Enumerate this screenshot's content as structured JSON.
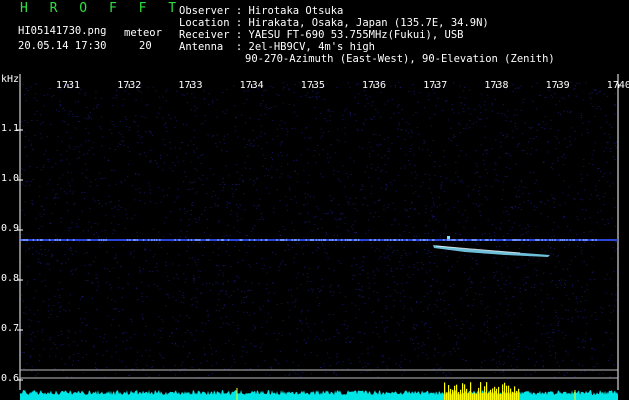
{
  "header": {
    "app_title": "H R O F F T",
    "filename": "HI05141730.png",
    "meteor_label": "meteor",
    "datetime": "20.05.14 17:30",
    "meteor_count": "20",
    "observer": "Observer : Hirotaka Otsuka",
    "location": "Location : Hirakata, Osaka, Japan (135.7E, 34.9N)",
    "receiver": "Receiver : YAESU FT-690 53.755MHz(Fukui), USB",
    "antenna": "Antenna  : 2el-HB9CV, 4m's high",
    "antenna2": "90-270-Azimuth (East-West), 90-Elevation (Zenith)"
  },
  "axes": {
    "y_unit": "kHz",
    "x_ticks": [
      "1731",
      "1732",
      "1733",
      "1734",
      "1735",
      "1736",
      "1737",
      "1738",
      "1739",
      "1740"
    ],
    "y_ticks": [
      "1.1",
      "1.0",
      "0.9",
      "0.8",
      "0.7",
      "0.6"
    ]
  },
  "colors": {
    "background": "#000000",
    "noise": "#1a1a7a",
    "carrier": "#3050ff",
    "meteor": "#80e0ff",
    "baseline": "#00ffff",
    "activity": "#ffff00"
  }
}
